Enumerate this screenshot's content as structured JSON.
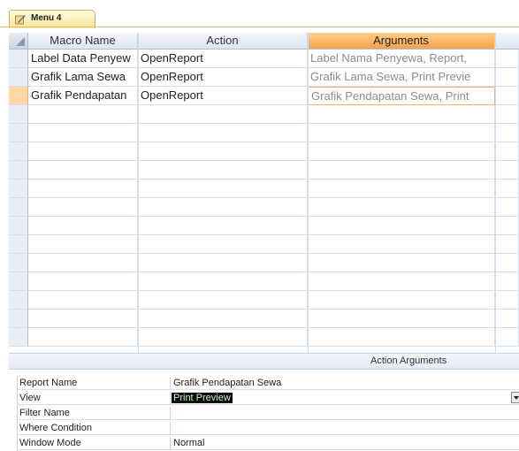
{
  "tab": {
    "label": "Menu 4",
    "icon": "macro-icon"
  },
  "grid": {
    "columns": [
      "Macro Name",
      "Action",
      "Arguments"
    ],
    "selected_column": "Arguments",
    "rows": [
      {
        "macro_name": "Label Data Penyew",
        "action": "OpenReport",
        "arguments": "Label Nama Penyewa, Report,"
      },
      {
        "macro_name": "Grafik Lama Sewa",
        "action": "OpenReport",
        "arguments": "Grafik Lama Sewa, Print Previe"
      },
      {
        "macro_name": "Grafik Pendapatan",
        "action": "OpenReport",
        "arguments": "Grafik Pendapatan Sewa, Print"
      }
    ],
    "active_row": 3
  },
  "action_arguments": {
    "title": "Action Arguments",
    "fields": [
      {
        "label": "Report Name",
        "value": "Grafik Pendapatan Sewa"
      },
      {
        "label": "View",
        "value": "Print Preview"
      },
      {
        "label": "Filter Name",
        "value": ""
      },
      {
        "label": "Where Condition",
        "value": ""
      },
      {
        "label": "Window Mode",
        "value": "Normal"
      }
    ]
  },
  "colors": {
    "selected_header": "#f9a34a",
    "grid_line": "#d5dde8"
  }
}
